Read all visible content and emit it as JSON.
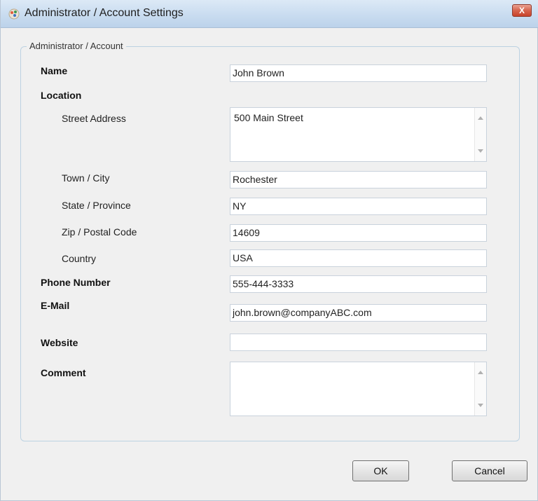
{
  "window": {
    "title": "Administrator / Account Settings",
    "icon": "app-icon",
    "close_label": "X"
  },
  "group": {
    "legend": "Administrator / Account"
  },
  "fields": {
    "name": {
      "label": "Name",
      "value": "John Brown"
    },
    "location": {
      "label": "Location"
    },
    "street": {
      "label": "Street Address",
      "value": "500 Main Street"
    },
    "town": {
      "label": "Town / City",
      "value": "Rochester"
    },
    "state": {
      "label": "State / Province",
      "value": "NY"
    },
    "zip": {
      "label": "Zip / Postal Code",
      "value": "14609"
    },
    "country": {
      "label": "Country",
      "value": "USA"
    },
    "phone": {
      "label": "Phone Number",
      "value": "555-444-3333"
    },
    "email": {
      "label": "E-Mail",
      "value": "john.brown@companyABC.com"
    },
    "website": {
      "label": "Website",
      "value": ""
    },
    "comment": {
      "label": "Comment",
      "value": ""
    }
  },
  "buttons": {
    "ok": "OK",
    "cancel": "Cancel"
  },
  "colors": {
    "titlebar": "#c9dcf0",
    "close": "#d7644d",
    "group_border": "#bcd2e2"
  }
}
